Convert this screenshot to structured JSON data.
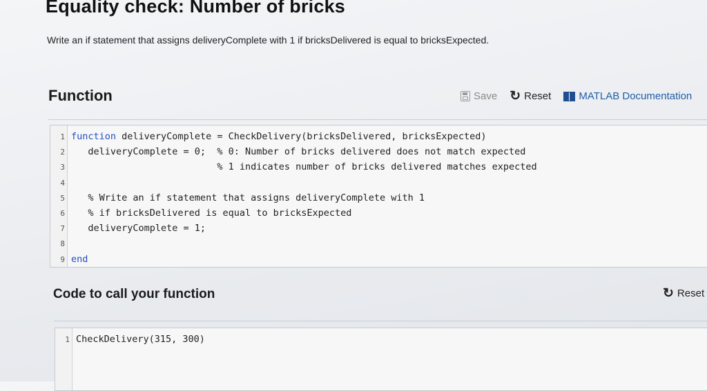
{
  "page": {
    "title": "Equality check: Number of bricks",
    "instructions": "Write an if statement that assigns deliveryComplete with 1 if bricksDelivered is equal to bricksExpected."
  },
  "function_section": {
    "title": "Function",
    "toolbar": {
      "save_label": "Save",
      "reset_label": "Reset",
      "docs_label": "MATLAB Documentation"
    },
    "code_lines": [
      {
        "num": "1",
        "kw": "function",
        "text": " deliveryComplete = CheckDelivery(bricksDelivered, bricksExpected)"
      },
      {
        "num": "2",
        "kw": "",
        "text": "   deliveryComplete = 0;  % 0: Number of bricks delivered does not match expected"
      },
      {
        "num": "3",
        "kw": "",
        "text": "                          % 1 indicates number of bricks delivered matches expected"
      },
      {
        "num": "4",
        "kw": "",
        "text": ""
      },
      {
        "num": "5",
        "kw": "",
        "text": "   % Write an if statement that assigns deliveryComplete with 1"
      },
      {
        "num": "6",
        "kw": "",
        "text": "   % if bricksDelivered is equal to bricksExpected"
      },
      {
        "num": "7",
        "kw": "",
        "text": "   deliveryComplete = 1;"
      },
      {
        "num": "8",
        "kw": "",
        "text": ""
      },
      {
        "num": "9",
        "kw": "end",
        "text": ""
      }
    ]
  },
  "call_section": {
    "title": "Code to call your function",
    "reset_label": "Reset",
    "code_lines": [
      {
        "num": "1",
        "text": "CheckDelivery(315, 300)"
      }
    ]
  },
  "colors": {
    "keyword": "#1f4fbf",
    "docs_link": "#1f5fa8"
  },
  "icons": [
    "save-icon",
    "reset-icon",
    "book-icon"
  ]
}
